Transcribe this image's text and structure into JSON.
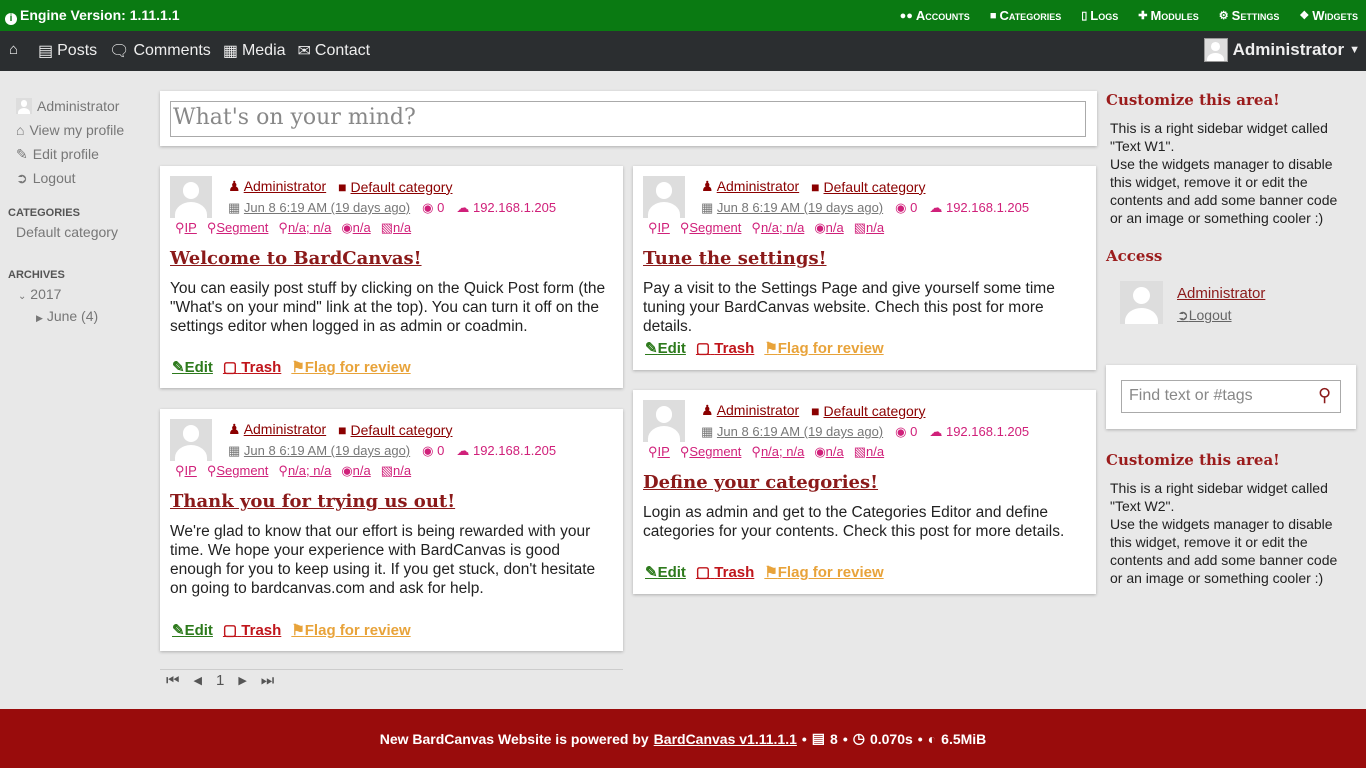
{
  "adminbar": {
    "version": "Engine Version: 1.11.1.1",
    "menu": [
      {
        "label": "Accounts",
        "icon": "users-icon"
      },
      {
        "label": "Categories",
        "icon": "folder-icon"
      },
      {
        "label": "Logs",
        "icon": "file-icon"
      },
      {
        "label": "Modules",
        "icon": "puzzle-icon"
      },
      {
        "label": "Settings",
        "icon": "gears-icon"
      },
      {
        "label": "Widgets",
        "icon": "cubes-icon"
      }
    ]
  },
  "mainnav": {
    "links": [
      {
        "label": "Posts",
        "icon": "newspaper-icon"
      },
      {
        "label": "Comments",
        "icon": "comments-icon"
      },
      {
        "label": "Media",
        "icon": "image-icon"
      },
      {
        "label": "Contact",
        "icon": "envelope-icon"
      }
    ],
    "user": "Administrator"
  },
  "leftbar": {
    "user": "Administrator",
    "view_profile": "View my profile",
    "edit_profile": "Edit profile",
    "logout": "Logout",
    "categories_heading": "CATEGORIES",
    "category": "Default category",
    "archives_heading": "ARCHIVES",
    "year": "2017",
    "month": "June (4)"
  },
  "quickpost": {
    "placeholder": "What's on your mind?"
  },
  "posts": [
    {
      "author": "Administrator",
      "category": "Default category",
      "date": "Jun 8 6:19 AM (19 days ago)",
      "views": "0",
      "ip": "192.168.1.205",
      "tag_ip": "IP",
      "tag_segment": "Segment",
      "tag_loc": "n/a; n/a",
      "tag_globe": "n/a",
      "tag_flag": "n/a",
      "title": "Welcome to BardCanvas!",
      "body": "You can easily post stuff by clicking on the Quick Post form (the \"What's on your mind\" link at the top). You can turn it off on the settings editor when logged in as admin or coadmin.",
      "edit": "Edit",
      "trash": "Trash",
      "flag": "Flag for review"
    },
    {
      "author": "Administrator",
      "category": "Default category",
      "date": "Jun 8 6:19 AM (19 days ago)",
      "views": "0",
      "ip": "192.168.1.205",
      "tag_ip": "IP",
      "tag_segment": "Segment",
      "tag_loc": "n/a; n/a",
      "tag_globe": "n/a",
      "tag_flag": "n/a",
      "title": "Tune the settings!",
      "body": "Pay a visit to the Settings Page and give yourself some time tuning your BardCanvas website. Chech this post for more details.",
      "edit": "Edit",
      "trash": "Trash",
      "flag": "Flag for review"
    },
    {
      "author": "Administrator",
      "category": "Default category",
      "date": "Jun 8 6:19 AM (19 days ago)",
      "views": "0",
      "ip": "192.168.1.205",
      "tag_ip": "IP",
      "tag_segment": "Segment",
      "tag_loc": "n/a; n/a",
      "tag_globe": "n/a",
      "tag_flag": "n/a",
      "title": "Thank you for trying us out!",
      "body": "We're glad to know that our effort is being rewarded with your time. We hope your experience with BardCanvas is good enough for you to keep using it. If you get stuck, don't hesitate on going to bardcanvas.com and ask for help.",
      "edit": "Edit",
      "trash": "Trash",
      "flag": "Flag for review"
    },
    {
      "author": "Administrator",
      "category": "Default category",
      "date": "Jun 8 6:19 AM (19 days ago)",
      "views": "0",
      "ip": "192.168.1.205",
      "tag_ip": "IP",
      "tag_segment": "Segment",
      "tag_loc": "n/a; n/a",
      "tag_globe": "n/a",
      "tag_flag": "n/a",
      "title": "Define your categories!",
      "body": "Login as admin and get to the Categories Editor and define categories for your contents. Check this post for more details.",
      "edit": "Edit",
      "trash": "Trash",
      "flag": "Flag for review"
    }
  ],
  "pager": {
    "page": "1"
  },
  "rightbar": {
    "w1_title": "Customize this area!",
    "w1_text1": "This is a right sidebar widget called \"Text W1\".",
    "w1_text2": "Use the widgets manager to disable this widget, remove it or edit the contents and add some banner code or an image or something cooler :)",
    "access_title": "Access",
    "access_user": "Administrator",
    "access_logout": "Logout",
    "search_placeholder": "Find text or #tags",
    "w2_title": "Customize this area!",
    "w2_text1": "This is a right sidebar widget called \"Text W2\".",
    "w2_text2": "Use the widgets manager to disable this widget, remove it or edit the contents and add some banner code or an image or something cooler :)"
  },
  "footer": {
    "prefix": "New BardCanvas Website is powered by",
    "link": "BardCanvas v1.11.1.1",
    "queries": "8",
    "time": "0.070s",
    "memory": "6.5MiB"
  }
}
